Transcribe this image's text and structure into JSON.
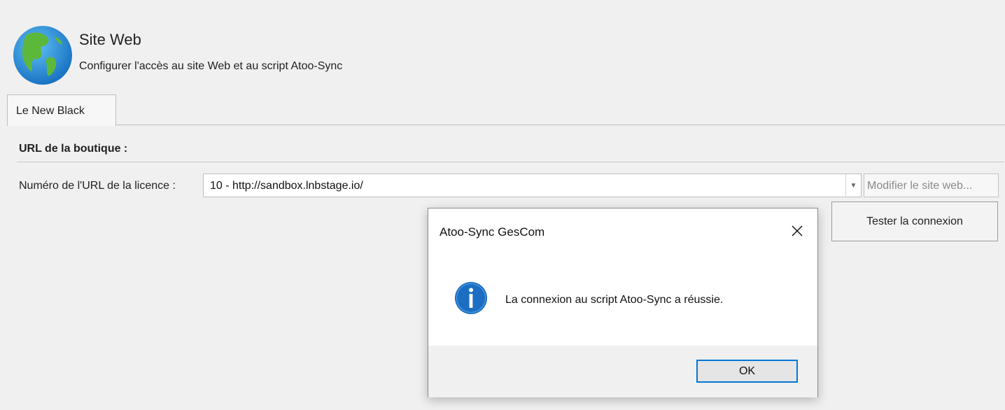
{
  "header": {
    "title": "Site Web",
    "subtitle": "Configurer l'accès au site Web et au script Atoo-Sync",
    "icon": "globe-icon"
  },
  "tabs": [
    {
      "label": "Le New Black",
      "selected": true
    }
  ],
  "group": {
    "title": "URL de la boutique :"
  },
  "license_url": {
    "label": "Numéro de l'URL de la licence :",
    "value": "10 - http://sandbox.lnbstage.io/",
    "edit_button": "Modifier le site web..."
  },
  "test_button": "Tester la connexion",
  "dialog": {
    "title": "Atoo-Sync GesCom",
    "message": "La connexion au script Atoo-Sync a réussie.",
    "icon": "info-icon",
    "ok_label": "OK",
    "accent": "#0078d7"
  }
}
